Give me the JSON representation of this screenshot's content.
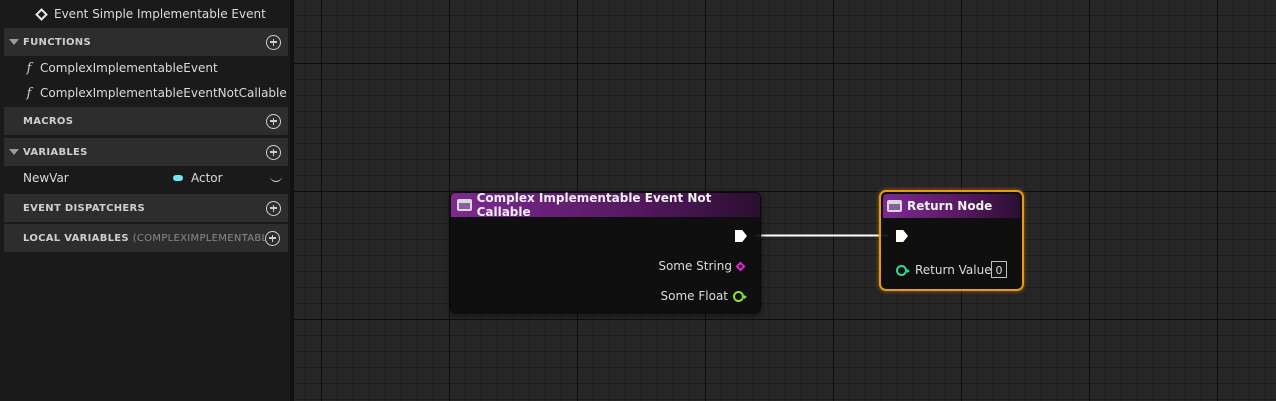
{
  "left_panel": {
    "event_item": "Event Simple Implementable Event",
    "functions": {
      "label": "FUNCTIONS",
      "items": [
        "ComplexImplementableEvent",
        "ComplexImplementableEventNotCallable"
      ]
    },
    "macros": {
      "label": "MACROS"
    },
    "variables": {
      "label": "VARIABLES",
      "items": [
        {
          "name": "NewVar",
          "type": "Actor",
          "type_color": "#6ee8f5"
        }
      ]
    },
    "event_dispatchers": {
      "label": "EVENT DISPATCHERS"
    },
    "local_variables": {
      "label": "LOCAL VARIABLES",
      "context": "(COMPLEXIMPLEMENTABLE"
    }
  },
  "graph": {
    "nodes": {
      "entry": {
        "title": "Complex Implementable Event Not Callable",
        "header_color": "#7d2a92",
        "pins": [
          {
            "label": "Some String",
            "type": "string",
            "color": "#e025d6"
          },
          {
            "label": "Some Float",
            "type": "float",
            "color": "#8de030"
          }
        ]
      },
      "return": {
        "title": "Return Node",
        "selected": true,
        "selection_color": "#e89a12",
        "pins": [
          {
            "label": "Return Value",
            "type": "int",
            "color": "#2fd6a6",
            "value": "0"
          }
        ]
      }
    },
    "wire_color": "#ffffff"
  }
}
